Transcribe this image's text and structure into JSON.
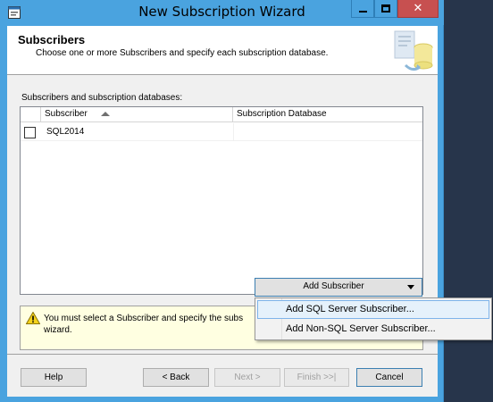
{
  "window": {
    "title": "New Subscription Wizard"
  },
  "header": {
    "title": "Subscribers",
    "subtitle": "Choose one or more Subscribers and specify each subscription database."
  },
  "grid": {
    "label": "Subscribers and subscription databases:",
    "columns": [
      "Subscriber",
      "Subscription Database"
    ],
    "rows": [
      {
        "checked": false,
        "subscriber": "SQL2014",
        "database": ""
      }
    ]
  },
  "add_subscriber": {
    "label": "Add Subscriber"
  },
  "dropdown": {
    "items": [
      "Add SQL Server Subscriber...",
      "Add Non-SQL Server Subscriber..."
    ]
  },
  "message": {
    "text": "You must select a Subscriber and specify the subs\nwizard."
  },
  "footer": {
    "help": "Help",
    "back": "< Back",
    "next": "Next >",
    "finish": "Finish >>|",
    "cancel": "Cancel"
  },
  "icons": {
    "app": "wizard-app-icon",
    "header": "database-replication-icon",
    "warning": "warning-icon",
    "sort": "sort-ascending-icon",
    "dropdown": "chevron-down-icon"
  },
  "colors": {
    "title_bar": "#4aa3df",
    "close_button": "#c75050",
    "message_background": "#ffffe1",
    "menu_hover": "#e5f1fb"
  }
}
